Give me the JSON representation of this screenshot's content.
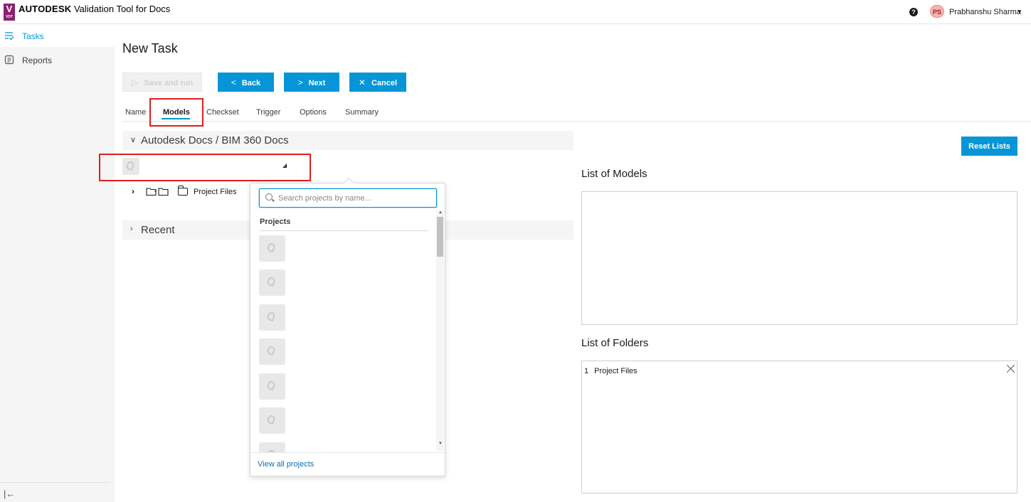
{
  "header": {
    "logo_letter": "V",
    "logo_sub": "VDT",
    "brand": "AUTODESK",
    "app_title": "Validation Tool for Docs",
    "help_icon": "question-circle-icon",
    "user_initials": "PS",
    "user_name": "Prabhanshu Sharma"
  },
  "sidebar": {
    "items": [
      {
        "label": "Tasks",
        "icon": "tasks-icon",
        "active": true
      },
      {
        "label": "Reports",
        "icon": "reports-icon",
        "active": false
      }
    ],
    "collapse_icon": "collapse-sidebar-icon"
  },
  "page": {
    "title": "New Task"
  },
  "toolbar": {
    "save_run_label": "Save and run",
    "back_label": "Back",
    "next_label": "Next",
    "cancel_label": "Cancel"
  },
  "tabs": [
    {
      "label": "Name"
    },
    {
      "label": "Models",
      "active": true
    },
    {
      "label": "Checkset"
    },
    {
      "label": "Trigger"
    },
    {
      "label": "Options"
    },
    {
      "label": "Summary"
    }
  ],
  "source_section": {
    "title": "Autodesk Docs / BIM 360 Docs",
    "expanded": true
  },
  "tree": {
    "folder_label": "Project Files"
  },
  "recent_section": {
    "title": "Recent",
    "expanded": false
  },
  "project_dropdown": {
    "search_placeholder": "Search projects by name...",
    "search_value": "",
    "group_label": "Projects",
    "item_count_visible": 7,
    "footer_link": "View all projects"
  },
  "right_panel": {
    "reset_label": "Reset Lists",
    "models_title": "List of Models",
    "folders_title": "List of Folders",
    "folders": [
      {
        "index": "1",
        "name": "Project Files"
      }
    ]
  },
  "colors": {
    "accent": "#0696d7",
    "highlight": "#e01e1e",
    "brand_badge": "#8a1f6f"
  }
}
